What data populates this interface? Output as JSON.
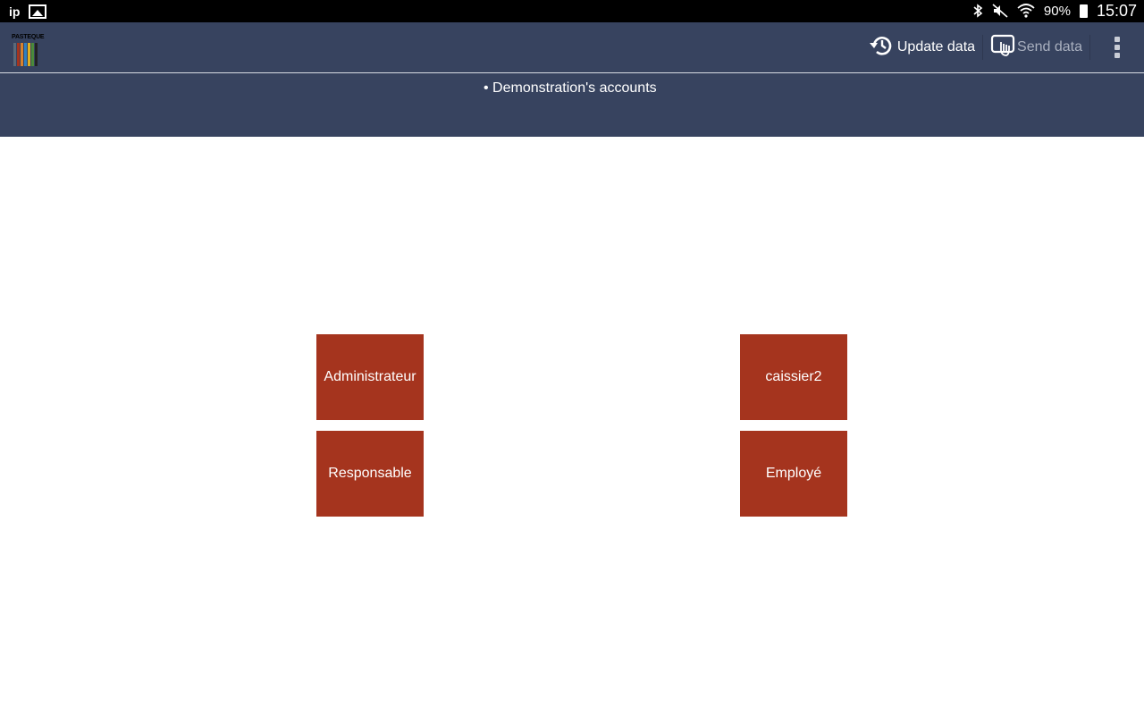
{
  "statusbar": {
    "ip_label": "ip",
    "battery": "90%",
    "time": "15:07",
    "icons": [
      "gallery-icon",
      "bluetooth-icon",
      "mute-icon",
      "wifi-icon",
      "battery-icon"
    ]
  },
  "toolbar": {
    "logo_text": "PASTEQUE",
    "update_label": "Update data",
    "send_label": "Send data",
    "icons": [
      "history-icon",
      "touch-send-icon",
      "overflow-menu-icon"
    ]
  },
  "subheader": {
    "account_line": "• Demonstration's accounts"
  },
  "users": [
    {
      "label": "Administrateur"
    },
    {
      "label": "caissier2"
    },
    {
      "label": "Responsable"
    },
    {
      "label": "Employé"
    }
  ],
  "colors": {
    "header_bg": "#37435f",
    "user_button_bg": "#a5341e",
    "disabled_text": "#a9b0bf"
  }
}
